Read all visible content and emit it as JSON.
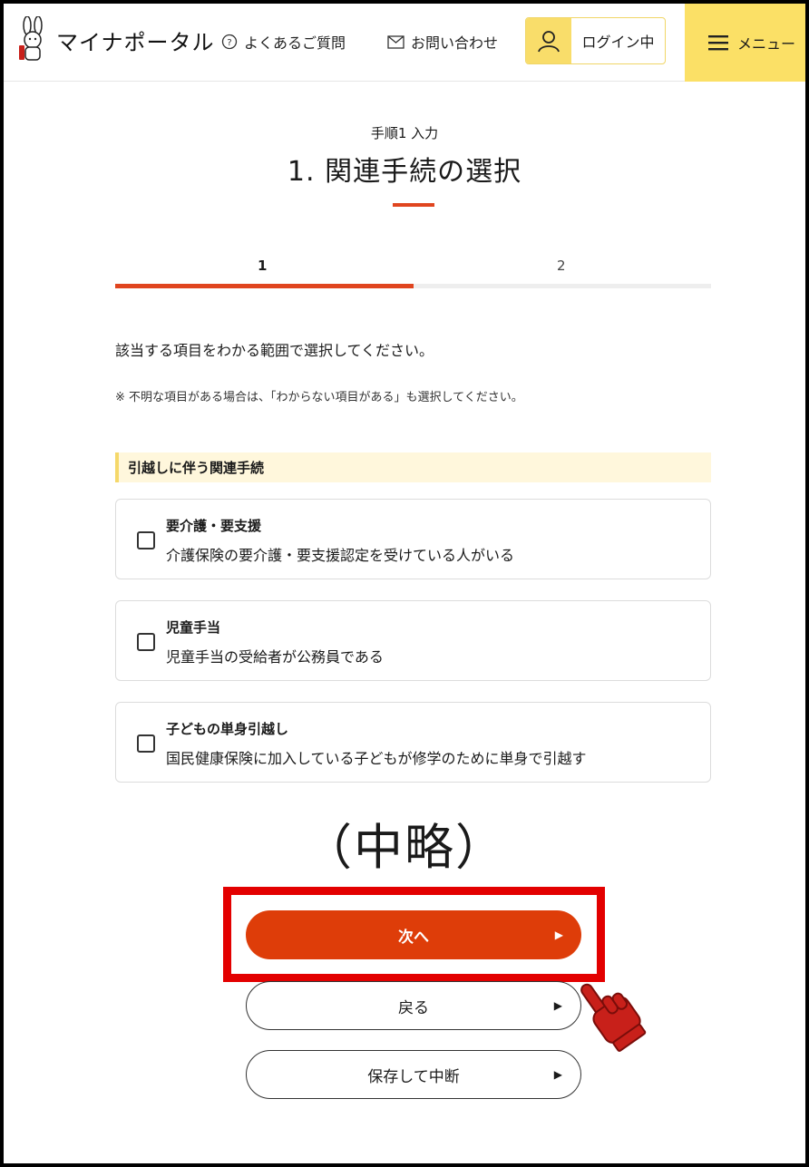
{
  "header": {
    "logo_text": "マイナポータル",
    "faq_label": "よくあるご質問",
    "contact_label": "お問い合わせ",
    "login_label": "ログイン中",
    "menu_label": "メニュー"
  },
  "page": {
    "step_caption": "手順1 入力",
    "title": "1. 関連手続の選択",
    "steps": [
      "1",
      "2"
    ],
    "progress_fraction": 0.5,
    "intro": "該当する項目をわかる範囲で選択してください。",
    "note": "※ 不明な項目がある場合は、「わからない項目がある」も選択してください。"
  },
  "section": {
    "heading": "引越しに伴う関連手続",
    "items": [
      {
        "title": "要介護・要支援",
        "desc": "介護保険の要介護・要支援認定を受けている人がいる",
        "checked": false
      },
      {
        "title": "児童手当",
        "desc": "児童手当の受給者が公務員である",
        "checked": false
      },
      {
        "title": "子どもの単身引越し",
        "desc": "国民健康保険に加入している子どもが修学のために単身で引越す",
        "checked": false
      }
    ]
  },
  "omitted_label": "（中略）",
  "buttons": {
    "next": "次へ",
    "back": "戻る",
    "save": "保存して中断"
  },
  "colors": {
    "accent": "#e0451f",
    "primary_button": "#de3d09",
    "header_yellow": "#fbe066",
    "highlight_red": "#e30000"
  }
}
